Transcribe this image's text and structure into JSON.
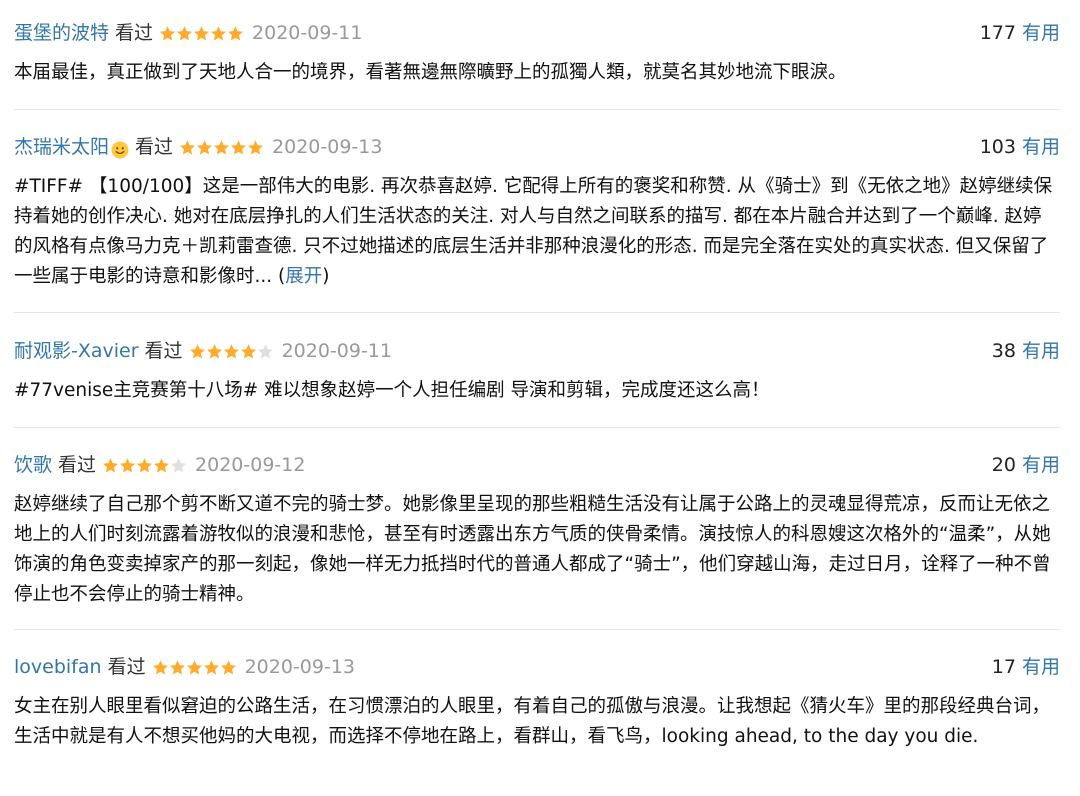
{
  "comments": [
    {
      "user": "蛋堡的波特",
      "watched_label": "看过",
      "rating": 5,
      "date": "2020-09-11",
      "votes": "177",
      "useful_label": "有用",
      "text": "本届最佳，真正做到了天地人合一的境界，看著無邊無際曠野上的孤獨人類，就莫名其妙地流下眼淚。"
    },
    {
      "user": "杰瑞米太阳",
      "user_icon": "smiley-emoji-icon",
      "watched_label": "看过",
      "rating": 5,
      "date": "2020-09-13",
      "votes": "103",
      "useful_label": "有用",
      "text": "#TIFF# 【100/100】这是一部伟大的电影. 再次恭喜赵婷. 它配得上所有的褒奖和称赞. 从《骑士》到《无依之地》赵婷继续保持着她的创作决心. 她对在底层挣扎的人们生活状态的关注. 对人与自然之间联系的描写. 都在本片融合并达到了一个巅峰. 赵婷的风格有点像马力克＋凯莉雷查德. 只不过她描述的底层生活并非那种浪漫化的形态. 而是完全落在实处的真实状态. 但又保留了一些属于电影的诗意和影像时... ",
      "expand_open": "(",
      "expand_label": "展开",
      "expand_close": ")"
    },
    {
      "user": "耐观影-Xavier",
      "watched_label": "看过",
      "rating": 4,
      "date": "2020-09-11",
      "votes": "38",
      "useful_label": "有用",
      "text": "#77venise主竞赛第十八场# 难以想象赵婷一个人担任编剧 导演和剪辑，完成度还这么高！"
    },
    {
      "user": "饮歌",
      "watched_label": "看过",
      "rating": 4,
      "date": "2020-09-12",
      "votes": "20",
      "useful_label": "有用",
      "text": "赵婷继续了自己那个剪不断又道不完的骑士梦。她影像里呈现的那些粗糙生活没有让属于公路上的灵魂显得荒凉，反而让无依之地上的人们时刻流露着游牧似的浪漫和悲怆，甚至有时透露出东方气质的侠骨柔情。演技惊人的科恩嫂这次格外的“温柔”，从她饰演的角色变卖掉家产的那一刻起，像她一样无力抵挡时代的普通人都成了“骑士”，他们穿越山海，走过日月，诠释了一种不曾停止也不会停止的骑士精神。"
    },
    {
      "user": "lovebifan",
      "watched_label": "看过",
      "rating": 5,
      "date": "2020-09-13",
      "votes": "17",
      "useful_label": "有用",
      "text": "女主在别人眼里看似窘迫的公路生活，在习惯漂泊的人眼里，有着自己的孤傲与浪漫。让我想起《猜火车》里的那段经典台词，生活中就是有人不想买他妈的大电视，而选择不停地在路上，看群山，看飞鸟，looking ahead, to the day you die."
    }
  ],
  "colors": {
    "link": "#3377aa",
    "star_filled": "#ffac2d",
    "star_empty": "#e0e0e0",
    "date": "#999999",
    "divider": "#e6e6e6"
  }
}
